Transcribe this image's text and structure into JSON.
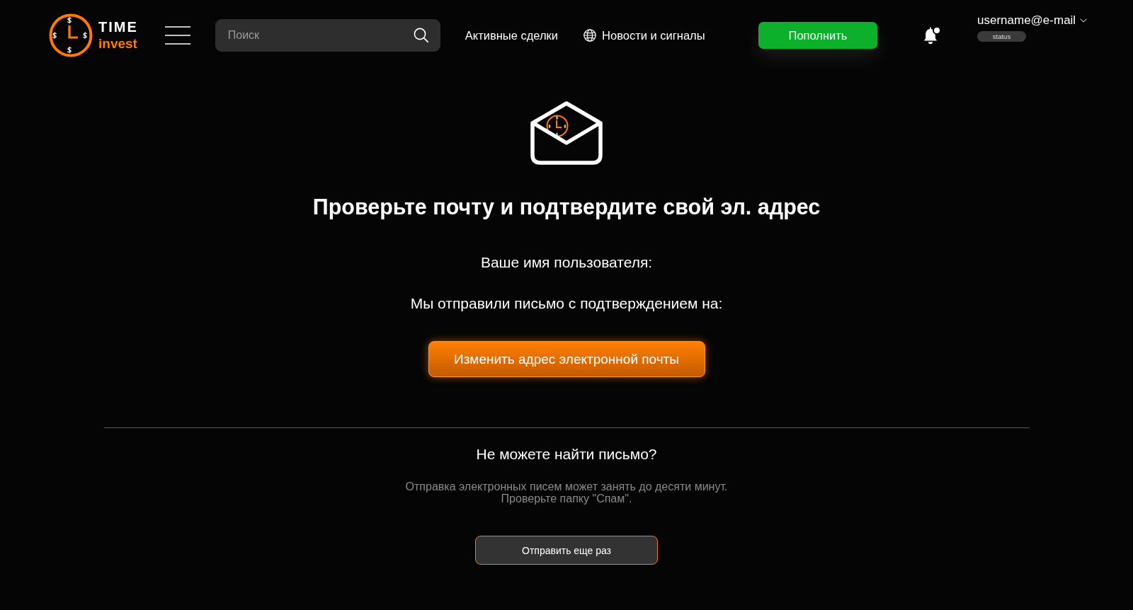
{
  "header": {
    "logo": {
      "name": "TIME",
      "tagline": "invest"
    },
    "search": {
      "placeholder": "Поиск"
    },
    "nav": [
      {
        "kind": "link",
        "label": "Активные сделки"
      },
      {
        "kind": "icon-link",
        "label": "Новости и сигналы"
      }
    ],
    "deposit_button": "Пополнить",
    "notifications": {
      "unread": true
    },
    "account": {
      "username": "username@e-mail",
      "status": "status"
    }
  },
  "main": {
    "title": "Проверьте почту и подтвердите свой эл. адрес",
    "username_label": "Ваше имя пользователя:",
    "sent_label": "Мы отправили письмо с подтверждением на:",
    "change_email_button": "Изменить адрес электронной почты"
  },
  "help": {
    "title": "Не можете найти письмо?",
    "text_lines": [
      "Отправка электронных писем может занять до десяти минут.",
      "Проверьте папку \"Спам\"."
    ],
    "resend_button": "Отправить еще раз"
  }
}
